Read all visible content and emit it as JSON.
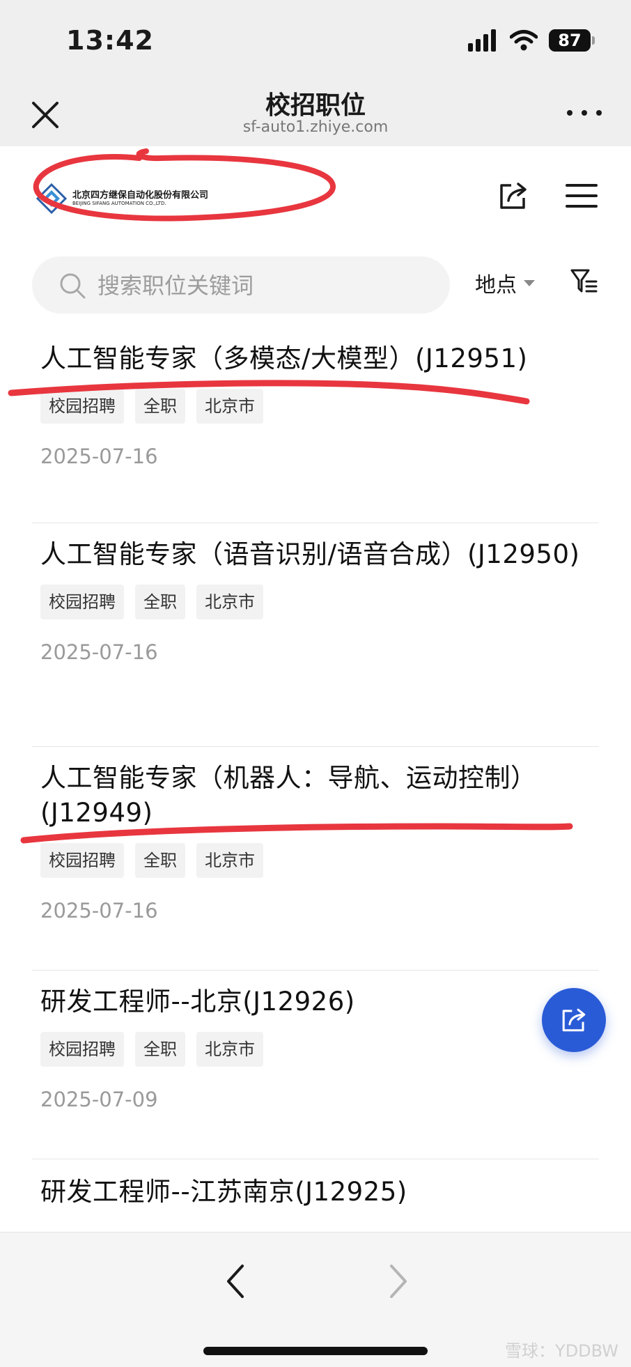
{
  "status_bar": {
    "time": "13:42",
    "battery": "87"
  },
  "nav": {
    "title": "校招职位",
    "url": "sf-auto1.zhiye.com"
  },
  "logo": {
    "name_cn": "北京四方继保自动化股份有限公司",
    "name_en": "BEIJING SIFANG AUTOMATION CO.,LTD."
  },
  "search": {
    "placeholder": "搜索职位关键词",
    "location_label": "地点"
  },
  "jobs": [
    {
      "title": "人工智能专家（多模态/大模型）(J12951)",
      "tags": [
        "校园招聘",
        "全职",
        "北京市"
      ],
      "date": "2025-07-16"
    },
    {
      "title": "人工智能专家（语音识别/语音合成）(J12950)",
      "tags": [
        "校园招聘",
        "全职",
        "北京市"
      ],
      "date": "2025-07-16"
    },
    {
      "title": "人工智能专家（机器人：导航、运动控制）(J12949)",
      "tags": [
        "校园招聘",
        "全职",
        "北京市"
      ],
      "date": "2025-07-16"
    },
    {
      "title": "研发工程师--北京(J12926)",
      "tags": [
        "校园招聘",
        "全职",
        "北京市"
      ],
      "date": "2025-07-09"
    },
    {
      "title": "研发工程师--江苏南京(J12925)",
      "tags": [],
      "date": ""
    }
  ],
  "watermark": "雪球：YDDBW",
  "colors": {
    "accent": "#2a5bd7",
    "annotation_red": "#e8363f"
  }
}
